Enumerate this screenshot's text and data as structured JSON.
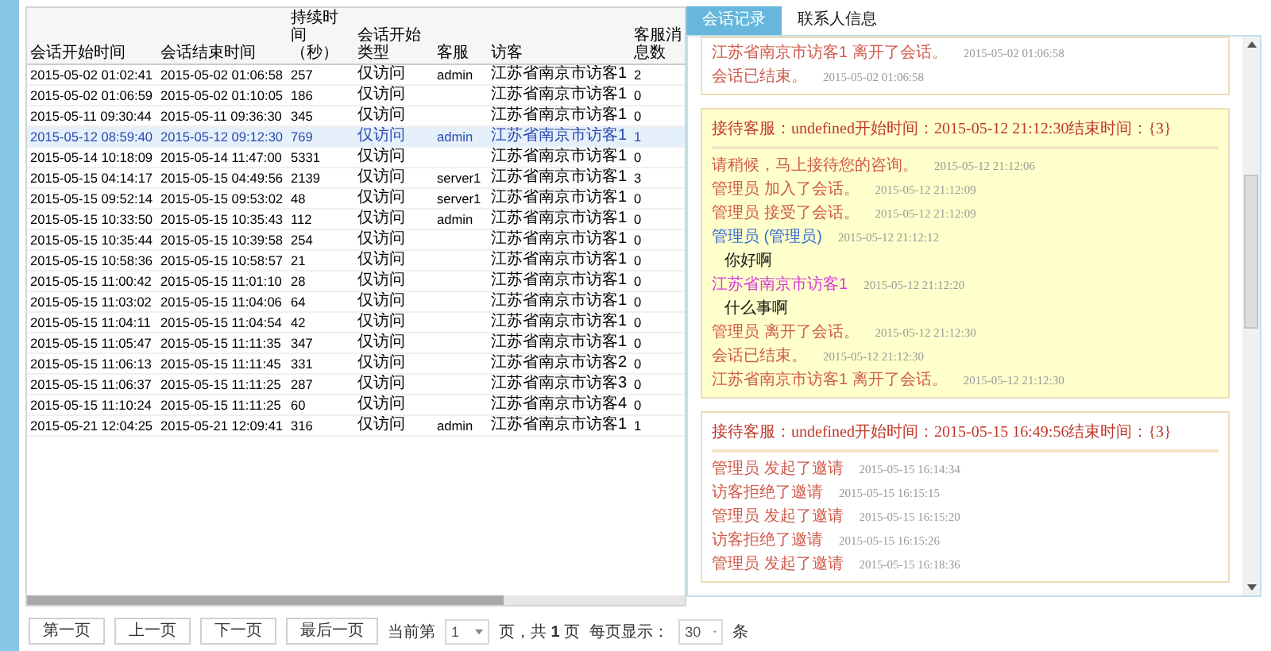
{
  "table": {
    "columns": [
      "会话开始时间",
      "会话结束时间",
      "持续时间（秒）",
      "会话开始类型",
      "客服",
      "访客",
      "客服消息数"
    ],
    "rows": [
      {
        "selected": false,
        "cells": [
          "2015-05-02 01:02:41",
          "2015-05-02 01:06:58",
          "257",
          "仅访问",
          "admin",
          "江苏省南京市访客1",
          "2"
        ]
      },
      {
        "selected": false,
        "cells": [
          "2015-05-02 01:06:59",
          "2015-05-02 01:10:05",
          "186",
          "仅访问",
          "",
          "江苏省南京市访客1",
          "0"
        ]
      },
      {
        "selected": false,
        "cells": [
          "2015-05-11 09:30:44",
          "2015-05-11 09:36:30",
          "345",
          "仅访问",
          "",
          "江苏省南京市访客1",
          "0"
        ]
      },
      {
        "selected": true,
        "cells": [
          "2015-05-12 08:59:40",
          "2015-05-12 09:12:30",
          "769",
          "仅访问",
          "admin",
          "江苏省南京市访客1",
          "1"
        ]
      },
      {
        "selected": false,
        "cells": [
          "2015-05-14 10:18:09",
          "2015-05-14 11:47:00",
          "5331",
          "仅访问",
          "",
          "江苏省南京市访客1",
          "0"
        ]
      },
      {
        "selected": false,
        "cells": [
          "2015-05-15 04:14:17",
          "2015-05-15 04:49:56",
          "2139",
          "仅访问",
          "server1",
          "江苏省南京市访客1",
          "3"
        ]
      },
      {
        "selected": false,
        "cells": [
          "2015-05-15 09:52:14",
          "2015-05-15 09:53:02",
          "48",
          "仅访问",
          "server1",
          "江苏省南京市访客1",
          "0"
        ]
      },
      {
        "selected": false,
        "cells": [
          "2015-05-15 10:33:50",
          "2015-05-15 10:35:43",
          "112",
          "仅访问",
          "admin",
          "江苏省南京市访客1",
          "0"
        ]
      },
      {
        "selected": false,
        "cells": [
          "2015-05-15 10:35:44",
          "2015-05-15 10:39:58",
          "254",
          "仅访问",
          "",
          "江苏省南京市访客1",
          "0"
        ]
      },
      {
        "selected": false,
        "cells": [
          "2015-05-15 10:58:36",
          "2015-05-15 10:58:57",
          "21",
          "仅访问",
          "",
          "江苏省南京市访客1",
          "0"
        ]
      },
      {
        "selected": false,
        "cells": [
          "2015-05-15 11:00:42",
          "2015-05-15 11:01:10",
          "28",
          "仅访问",
          "",
          "江苏省南京市访客1",
          "0"
        ]
      },
      {
        "selected": false,
        "cells": [
          "2015-05-15 11:03:02",
          "2015-05-15 11:04:06",
          "64",
          "仅访问",
          "",
          "江苏省南京市访客1",
          "0"
        ]
      },
      {
        "selected": false,
        "cells": [
          "2015-05-15 11:04:11",
          "2015-05-15 11:04:54",
          "42",
          "仅访问",
          "",
          "江苏省南京市访客1",
          "0"
        ]
      },
      {
        "selected": false,
        "cells": [
          "2015-05-15 11:05:47",
          "2015-05-15 11:11:35",
          "347",
          "仅访问",
          "",
          "江苏省南京市访客1",
          "0"
        ]
      },
      {
        "selected": false,
        "cells": [
          "2015-05-15 11:06:13",
          "2015-05-15 11:11:45",
          "331",
          "仅访问",
          "",
          "江苏省南京市访客2",
          "0"
        ]
      },
      {
        "selected": false,
        "cells": [
          "2015-05-15 11:06:37",
          "2015-05-15 11:11:25",
          "287",
          "仅访问",
          "",
          "江苏省南京市访客3",
          "0"
        ]
      },
      {
        "selected": false,
        "cells": [
          "2015-05-15 11:10:24",
          "2015-05-15 11:11:25",
          "60",
          "仅访问",
          "",
          "江苏省南京市访客4",
          "0"
        ]
      },
      {
        "selected": false,
        "cells": [
          "2015-05-21 12:04:25",
          "2015-05-21 12:09:41",
          "316",
          "仅访问",
          "admin",
          "江苏省南京市访客1",
          "1"
        ]
      }
    ]
  },
  "pagination": {
    "buttons": [
      "第一页",
      "上一页",
      "下一页",
      "最后一页"
    ],
    "current_label": "当前第",
    "current_page": "1",
    "total_text": "页，共 **1** 页",
    "page_size_label": "每页显示：",
    "page_size": "30",
    "page_size_unit": "条"
  },
  "tabs": [
    {
      "label": "会话记录",
      "selected": true
    },
    {
      "label": "联系人信息",
      "selected": false
    }
  ],
  "sessions": [
    {
      "highlighted": false,
      "entries": [
        {
          "kind": "system",
          "text": "江苏省南京市访客1 离开了会话。",
          "time": "2015-05-02 01:06:58"
        },
        {
          "kind": "system",
          "text": "会话已结束。",
          "time": "2015-05-02 01:06:58"
        }
      ]
    },
    {
      "highlighted": true,
      "header": "接待客服：undefined开始时间：2015-05-12 21:12:30结束时间：{3}",
      "entries": [
        {
          "kind": "system",
          "text": "请稍候，马上接待您的咨询。",
          "time": "2015-05-12 21:12:06"
        },
        {
          "kind": "system",
          "text": "管理员 加入了会话。",
          "time": "2015-05-12 21:12:09"
        },
        {
          "kind": "system",
          "text": "管理员 接受了会话。",
          "time": "2015-05-12 21:12:09"
        },
        {
          "kind": "agent",
          "text": "管理员 (管理员)",
          "time": "2015-05-12 21:12:12"
        },
        {
          "kind": "message",
          "text": "你好啊"
        },
        {
          "kind": "visitor",
          "text": "江苏省南京市访客1",
          "time": "2015-05-12 21:12:20"
        },
        {
          "kind": "message",
          "text": "什么事啊"
        },
        {
          "kind": "system",
          "text": "管理员 离开了会话。",
          "time": "2015-05-12 21:12:30"
        },
        {
          "kind": "system",
          "text": "会话已结束。",
          "time": "2015-05-12 21:12:30"
        },
        {
          "kind": "system",
          "text": "江苏省南京市访客1 离开了会话。",
          "time": "2015-05-12 21:12:30"
        }
      ]
    },
    {
      "highlighted": false,
      "header": "接待客服：undefined开始时间：2015-05-15 16:49:56结束时间：{3}",
      "entries": [
        {
          "kind": "system",
          "text": "管理员 发起了邀请",
          "time": "2015-05-15 16:14:34"
        },
        {
          "kind": "system",
          "text": "访客拒绝了邀请",
          "time": "2015-05-15 16:15:15"
        },
        {
          "kind": "system",
          "text": "管理员 发起了邀请",
          "time": "2015-05-15 16:15:20"
        },
        {
          "kind": "system",
          "text": "访客拒绝了邀请",
          "time": "2015-05-15 16:15:26"
        },
        {
          "kind": "system",
          "text": "管理员 发起了邀请",
          "time": "2015-05-15 16:18:36"
        }
      ]
    }
  ]
}
